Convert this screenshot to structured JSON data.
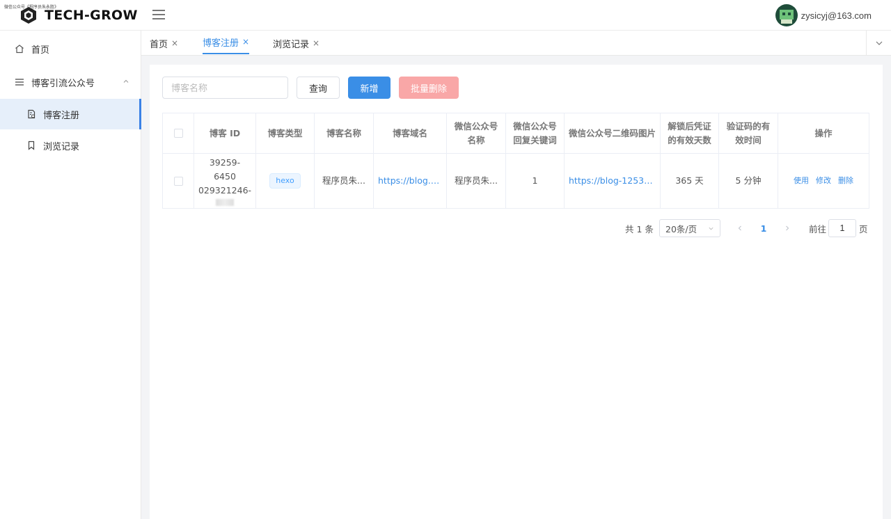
{
  "watermark": "微信公众号《程序员朱永胜》",
  "brand": {
    "name": "TECH-GROW"
  },
  "user": {
    "email": "zysicyj@163.com"
  },
  "sidebar": {
    "items": [
      {
        "label": "首页",
        "icon": "home-icon"
      },
      {
        "label": "博客引流公众号",
        "icon": "menu-icon"
      },
      {
        "label": "博客注册",
        "icon": "document-icon",
        "active": true
      },
      {
        "label": "浏览记录",
        "icon": "bookmark-icon"
      }
    ]
  },
  "tabs": [
    {
      "label": "首页",
      "close": "×"
    },
    {
      "label": "博客注册",
      "close": "×",
      "active": true
    },
    {
      "label": "浏览记录",
      "close": "×"
    }
  ],
  "search": {
    "placeholder": "博客名称"
  },
  "toolbar": {
    "query_label": "查询",
    "add_label": "新增",
    "batch_delete_label": "批量删除"
  },
  "table": {
    "columns": [
      "博客 ID",
      "博客类型",
      "博客名称",
      "博客域名",
      "微信公众号名称",
      "微信公众号回复关键词",
      "微信公众号二维码图片",
      "解锁后凭证的有效天数",
      "验证码的有效时间",
      "操作"
    ],
    "rows": [
      {
        "id_line1": "39259-6450",
        "id_line2": "029321246-",
        "type": "hexo",
        "name": "程序员朱...",
        "domain": "https://blog.z...",
        "wechat_name": "程序员朱...",
        "keyword": "1",
        "qrcode": "https://blog-125365...",
        "valid_days": "365 天",
        "code_time": "5 分钟",
        "ops": [
          "使用",
          "修改",
          "删除"
        ]
      }
    ]
  },
  "pagination": {
    "total": "共 1 条",
    "page_size": "20条/页",
    "current_page": "1",
    "goto_label": "前往",
    "goto_value": "1",
    "page_unit": "页"
  },
  "colors": {
    "primary": "#3a8ee6",
    "danger_disabled": "#f9a7a7",
    "active_bg": "#e6effa"
  }
}
